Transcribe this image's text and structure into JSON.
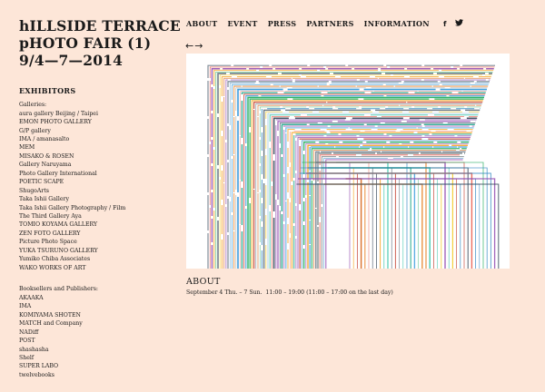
{
  "site": {
    "title_lines": [
      "hILLSIDE TERRACE",
      "pHOTO FAIR (1)",
      "9/4—7—2014"
    ]
  },
  "nav": {
    "items": [
      "ABOUT",
      "EVENT",
      "PRESS",
      "PARTNERS",
      "INFORMATION"
    ],
    "social": {
      "facebook": "f",
      "twitter": "🐦"
    }
  },
  "slider": {
    "prev": "←",
    "next": "→"
  },
  "sidebar": {
    "heading": "EXHIBITORS",
    "galleries_label": "Galleries:",
    "galleries": [
      "aura gallery Beijing / Taipei",
      "EMON PHOTO GALLERY",
      "G/P gallery",
      "IMA / amanasalto",
      "MEM",
      "MISAKO & ROSEN",
      "Gallery Naruyama",
      "Photo Gallery International",
      "POETIC SCAPE",
      "ShugoArts",
      "Taka Ishii Gallery",
      "Taka Ishii Gallery Photography / Film",
      "The Third Gallery Aya",
      "TOMIO KOYAMA GALLERY",
      "ZEN FOTO GALLERY",
      "Picture Photo Space",
      "YUKA TSURUNO GALLERY",
      "Yumiko Chiba Associates",
      "WAKO WORKS OF ART"
    ],
    "booksellers_label": "Booksellers and Publishers:",
    "booksellers": [
      "AKAAKA",
      "IMA",
      "KOMIYAMA SHOTEN",
      "MATCH and Company",
      "NADiff",
      "POST",
      "shashasha",
      "Shelf",
      "SUPER LABO",
      "twelvebooks"
    ]
  },
  "about": {
    "heading": "ABOUT",
    "text": "September 4 Thu. – 7 Sun.  11:00 – 19:00 (11:00 – 17:00 on the last day)"
  },
  "colors": {
    "background": "#fde6d8",
    "text": "#1a1a1a",
    "hero_bg": "#ffffff"
  }
}
